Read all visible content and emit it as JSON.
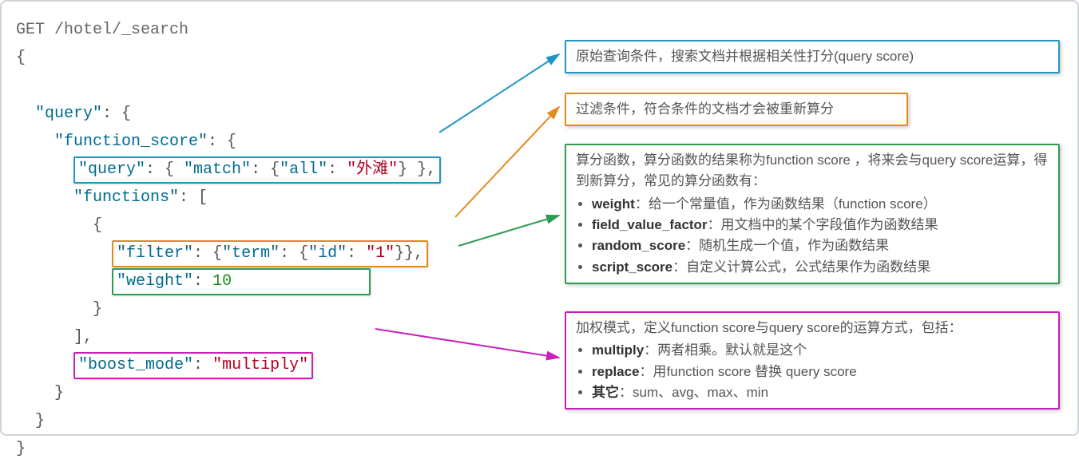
{
  "code": {
    "line1": "GET /hotel/_search",
    "line2": "{",
    "line3_indent": "  ",
    "query_key": "\"query\"",
    "colon_brace": ": {",
    "function_score_key": "\"function_score\"",
    "inner_query_key": "\"query\"",
    "match_key": "\"match\"",
    "all_key": "\"all\"",
    "all_val": "\"外滩\"",
    "functions_key": "\"functions\"",
    "filter_key": "\"filter\"",
    "term_key": "\"term\"",
    "id_key": "\"id\"",
    "id_val": "\"1\"",
    "weight_key": "\"weight\"",
    "weight_val": "10",
    "boost_mode_key": "\"boost_mode\"",
    "boost_mode_val": "\"multiply\""
  },
  "callouts": {
    "c1": "原始查询条件，搜索文档并根据相关性打分(query score)",
    "c2": "过滤条件，符合条件的文档才会被重新算分",
    "c3_intro": "算分函数，算分函数的结果称为function score ，将来会与query score运算，得到新算分，常见的算分函数有：",
    "c3_item1_label": "weight",
    "c3_item1_text": "：给一个常量值，作为函数结果（function score）",
    "c3_item2_label": "field_value_factor",
    "c3_item2_text": "：用文档中的某个字段值作为函数结果",
    "c3_item3_label": "random_score",
    "c3_item3_text": "：随机生成一个值，作为函数结果",
    "c3_item4_label": "script_score",
    "c3_item4_text": "：自定义计算公式，公式结果作为函数结果",
    "c4_intro": "加权模式，定义function score与query score的运算方式，包括：",
    "c4_item1_label": "multiply",
    "c4_item1_text": "：两者相乘。默认就是这个",
    "c4_item2_label": "replace",
    "c4_item2_text": "：用function score 替换 query score",
    "c4_item3_label": "其它",
    "c4_item3_text": "：sum、avg、max、min"
  }
}
